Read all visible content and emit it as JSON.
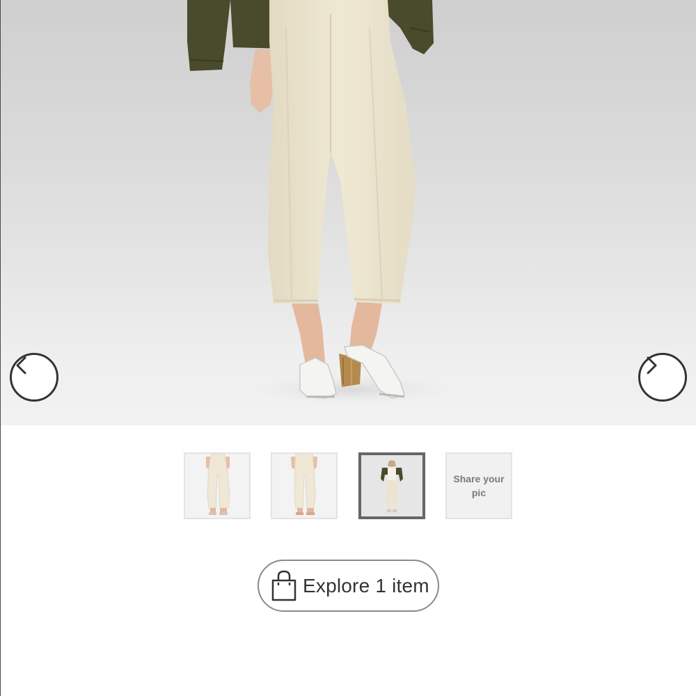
{
  "gallery": {
    "images": [
      {
        "alt": "Women's pants front view"
      },
      {
        "alt": "Women's pants back view"
      },
      {
        "alt": "Model wearing pants with olive jacket"
      }
    ],
    "selected_index": 2,
    "share_label": "Share your pic"
  },
  "navigation": {
    "prev_icon": "chevron-left-icon",
    "next_icon": "chevron-right-icon"
  },
  "explore": {
    "label": "Explore 1 item",
    "icon": "shopping-bag-icon"
  },
  "colors": {
    "jacket": "#4a4a2c",
    "pants": "#eee6cf",
    "sandals": "#f4f4f2",
    "heel": "#b58a4c",
    "skin": "#e6bfa6",
    "button_border": "#8a8a8a",
    "selected_thumb_border": "#666666"
  }
}
